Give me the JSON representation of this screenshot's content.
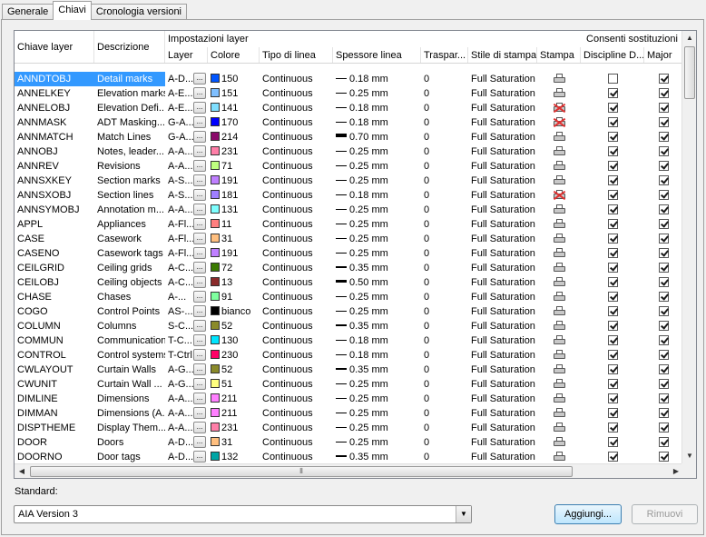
{
  "tabs": [
    "Generale",
    "Chiavi",
    "Cronologia versioni"
  ],
  "active_tab": 1,
  "headers": {
    "chiave": "Chiave layer",
    "descrizione": "Descrizione",
    "impostazioni": "Impostazioni layer",
    "consenti": "Consenti sostituzioni",
    "layer": "Layer",
    "colore": "Colore",
    "tipo": "Tipo di linea",
    "spessore": "Spessore linea",
    "trasparenza": "Traspar...",
    "stile": "Stile di stampa",
    "stampa": "Stampa",
    "discipline": "Discipline D...",
    "major": "Major"
  },
  "colors": {
    "selection": "#3399ff",
    "noplot": "#e03030"
  },
  "rows": [
    {
      "key": "ANNDTOBJ",
      "desc": "Detail marks",
      "layer": "A-D...",
      "color": "150",
      "swatch": "#0055ff",
      "lt": "Continuous",
      "lw": "0.18 mm",
      "lwh": 1,
      "tr": "0",
      "ps": "Full Saturation",
      "plot": true,
      "dis": false,
      "maj": true,
      "sel": true
    },
    {
      "key": "ANNELKEY",
      "desc": "Elevation marks",
      "layer": "A-E...",
      "color": "151",
      "swatch": "#7fbfff",
      "lt": "Continuous",
      "lw": "0.25 mm",
      "lwh": 1,
      "tr": "0",
      "ps": "Full Saturation",
      "plot": true,
      "dis": true,
      "maj": true
    },
    {
      "key": "ANNELOBJ",
      "desc": "Elevation Defi...",
      "layer": "A-E...",
      "color": "141",
      "swatch": "#7fdfff",
      "lt": "Continuous",
      "lw": "0.18 mm",
      "lwh": 1,
      "tr": "0",
      "ps": "Full Saturation",
      "plot": false,
      "dis": true,
      "maj": true
    },
    {
      "key": "ANNMASK",
      "desc": "ADT Masking...",
      "layer": "G-A...",
      "color": "170",
      "swatch": "#0000ff",
      "lt": "Continuous",
      "lw": "0.18 mm",
      "lwh": 1,
      "tr": "0",
      "ps": "Full Saturation",
      "plot": false,
      "dis": true,
      "maj": true
    },
    {
      "key": "ANNMATCH",
      "desc": "Match Lines",
      "layer": "G-A...",
      "color": "214",
      "swatch": "#8a0a6a",
      "lt": "Continuous",
      "lw": "0.70 mm",
      "lwh": 4,
      "tr": "0",
      "ps": "Full Saturation",
      "plot": true,
      "dis": true,
      "maj": true
    },
    {
      "key": "ANNOBJ",
      "desc": "Notes, leader...",
      "layer": "A-A...",
      "color": "231",
      "swatch": "#ff7fa8",
      "lt": "Continuous",
      "lw": "0.25 mm",
      "lwh": 1,
      "tr": "0",
      "ps": "Full Saturation",
      "plot": true,
      "dis": true,
      "maj": true
    },
    {
      "key": "ANNREV",
      "desc": "Revisions",
      "layer": "A-A...",
      "color": "71",
      "swatch": "#bfff7f",
      "lt": "Continuous",
      "lw": "0.25 mm",
      "lwh": 1,
      "tr": "0",
      "ps": "Full Saturation",
      "plot": true,
      "dis": true,
      "maj": true
    },
    {
      "key": "ANNSXKEY",
      "desc": "Section marks",
      "layer": "A-S...",
      "color": "191",
      "swatch": "#bf7fff",
      "lt": "Continuous",
      "lw": "0.25 mm",
      "lwh": 1,
      "tr": "0",
      "ps": "Full Saturation",
      "plot": true,
      "dis": true,
      "maj": true
    },
    {
      "key": "ANNSXOBJ",
      "desc": "Section lines",
      "layer": "A-S...",
      "color": "181",
      "swatch": "#9f7fff",
      "lt": "Continuous",
      "lw": "0.18 mm",
      "lwh": 1,
      "tr": "0",
      "ps": "Full Saturation",
      "plot": false,
      "dis": true,
      "maj": true
    },
    {
      "key": "ANNSYMOBJ",
      "desc": "Annotation m...",
      "layer": "A-A...",
      "color": "131",
      "swatch": "#7fffff",
      "lt": "Continuous",
      "lw": "0.25 mm",
      "lwh": 1,
      "tr": "0",
      "ps": "Full Saturation",
      "plot": true,
      "dis": true,
      "maj": true
    },
    {
      "key": "APPL",
      "desc": "Appliances",
      "layer": "A-Fl...",
      "color": "11",
      "swatch": "#ff7f7f",
      "lt": "Continuous",
      "lw": "0.25 mm",
      "lwh": 1,
      "tr": "0",
      "ps": "Full Saturation",
      "plot": true,
      "dis": true,
      "maj": true
    },
    {
      "key": "CASE",
      "desc": "Casework",
      "layer": "A-Fl...",
      "color": "31",
      "swatch": "#ffbf7f",
      "lt": "Continuous",
      "lw": "0.25 mm",
      "lwh": 1,
      "tr": "0",
      "ps": "Full Saturation",
      "plot": true,
      "dis": true,
      "maj": true
    },
    {
      "key": "CASENO",
      "desc": "Casework tags",
      "layer": "A-Fl...",
      "color": "191",
      "swatch": "#bf7fff",
      "lt": "Continuous",
      "lw": "0.25 mm",
      "lwh": 1,
      "tr": "0",
      "ps": "Full Saturation",
      "plot": true,
      "dis": true,
      "maj": true
    },
    {
      "key": "CEILGRID",
      "desc": "Ceiling grids",
      "layer": "A-C...",
      "color": "72",
      "swatch": "#3a7a00",
      "lt": "Continuous",
      "lw": "0.35 mm",
      "lwh": 2,
      "tr": "0",
      "ps": "Full Saturation",
      "plot": true,
      "dis": true,
      "maj": true
    },
    {
      "key": "CEILOBJ",
      "desc": "Ceiling objects",
      "layer": "A-C...",
      "color": "13",
      "swatch": "#8a2a2a",
      "lt": "Continuous",
      "lw": "0.50 mm",
      "lwh": 3,
      "tr": "0",
      "ps": "Full Saturation",
      "plot": true,
      "dis": true,
      "maj": true
    },
    {
      "key": "CHASE",
      "desc": "Chases",
      "layer": "A-...",
      "color": "91",
      "swatch": "#7fff9f",
      "lt": "Continuous",
      "lw": "0.25 mm",
      "lwh": 1,
      "tr": "0",
      "ps": "Full Saturation",
      "plot": true,
      "dis": true,
      "maj": true
    },
    {
      "key": "COGO",
      "desc": "Control Points",
      "layer": "AS-...",
      "color": "bianco",
      "swatch": "#000000",
      "lt": "Continuous",
      "lw": "0.25 mm",
      "lwh": 1,
      "tr": "0",
      "ps": "Full Saturation",
      "plot": true,
      "dis": true,
      "maj": true
    },
    {
      "key": "COLUMN",
      "desc": "Columns",
      "layer": "S-C...",
      "color": "52",
      "swatch": "#8a8a2a",
      "lt": "Continuous",
      "lw": "0.35 mm",
      "lwh": 2,
      "tr": "0",
      "ps": "Full Saturation",
      "plot": true,
      "dis": true,
      "maj": true
    },
    {
      "key": "COMMUN",
      "desc": "Communication",
      "layer": "T-C...",
      "color": "130",
      "swatch": "#00e5ff",
      "lt": "Continuous",
      "lw": "0.18 mm",
      "lwh": 1,
      "tr": "0",
      "ps": "Full Saturation",
      "plot": true,
      "dis": true,
      "maj": true
    },
    {
      "key": "CONTROL",
      "desc": "Control systems",
      "layer": "T-Ctrl",
      "color": "230",
      "swatch": "#ff0066",
      "lt": "Continuous",
      "lw": "0.18 mm",
      "lwh": 1,
      "tr": "0",
      "ps": "Full Saturation",
      "plot": true,
      "dis": true,
      "maj": true
    },
    {
      "key": "CWLAYOUT",
      "desc": "Curtain Walls",
      "layer": "A-G...",
      "color": "52",
      "swatch": "#8a8a2a",
      "lt": "Continuous",
      "lw": "0.35 mm",
      "lwh": 2,
      "tr": "0",
      "ps": "Full Saturation",
      "plot": true,
      "dis": true,
      "maj": true
    },
    {
      "key": "CWUNIT",
      "desc": "Curtain Wall ...",
      "layer": "A-G...",
      "color": "51",
      "swatch": "#ffff7f",
      "lt": "Continuous",
      "lw": "0.25 mm",
      "lwh": 1,
      "tr": "0",
      "ps": "Full Saturation",
      "plot": true,
      "dis": true,
      "maj": true
    },
    {
      "key": "DIMLINE",
      "desc": "Dimensions",
      "layer": "A-A...",
      "color": "211",
      "swatch": "#ff7fff",
      "lt": "Continuous",
      "lw": "0.25 mm",
      "lwh": 1,
      "tr": "0",
      "ps": "Full Saturation",
      "plot": true,
      "dis": true,
      "maj": true
    },
    {
      "key": "DIMMAN",
      "desc": "Dimensions (A...",
      "layer": "A-A...",
      "color": "211",
      "swatch": "#ff7fff",
      "lt": "Continuous",
      "lw": "0.25 mm",
      "lwh": 1,
      "tr": "0",
      "ps": "Full Saturation",
      "plot": true,
      "dis": true,
      "maj": true
    },
    {
      "key": "DISPTHEME",
      "desc": "Display Them...",
      "layer": "A-A...",
      "color": "231",
      "swatch": "#ff7fa8",
      "lt": "Continuous",
      "lw": "0.25 mm",
      "lwh": 1,
      "tr": "0",
      "ps": "Full Saturation",
      "plot": true,
      "dis": true,
      "maj": true
    },
    {
      "key": "DOOR",
      "desc": "Doors",
      "layer": "A-D...",
      "color": "31",
      "swatch": "#ffbf7f",
      "lt": "Continuous",
      "lw": "0.25 mm",
      "lwh": 1,
      "tr": "0",
      "ps": "Full Saturation",
      "plot": true,
      "dis": true,
      "maj": true
    },
    {
      "key": "DOORNO",
      "desc": "Door tags",
      "layer": "A-D...",
      "color": "132",
      "swatch": "#00a5a5",
      "lt": "Continuous",
      "lw": "0.35 mm",
      "lwh": 2,
      "tr": "0",
      "ps": "Full Saturation",
      "plot": true,
      "dis": true,
      "maj": true
    }
  ],
  "standard_label": "Standard:",
  "standard_value": "AIA Version 3",
  "buttons": {
    "add": "Aggiungi...",
    "remove": "Rimuovi"
  },
  "icons": {
    "layer_browse": "...",
    "scroll_up": "▲",
    "scroll_down": "▼",
    "scroll_left": "◀",
    "scroll_right": "▶",
    "grip": "⦀",
    "dropdown": "▼"
  }
}
